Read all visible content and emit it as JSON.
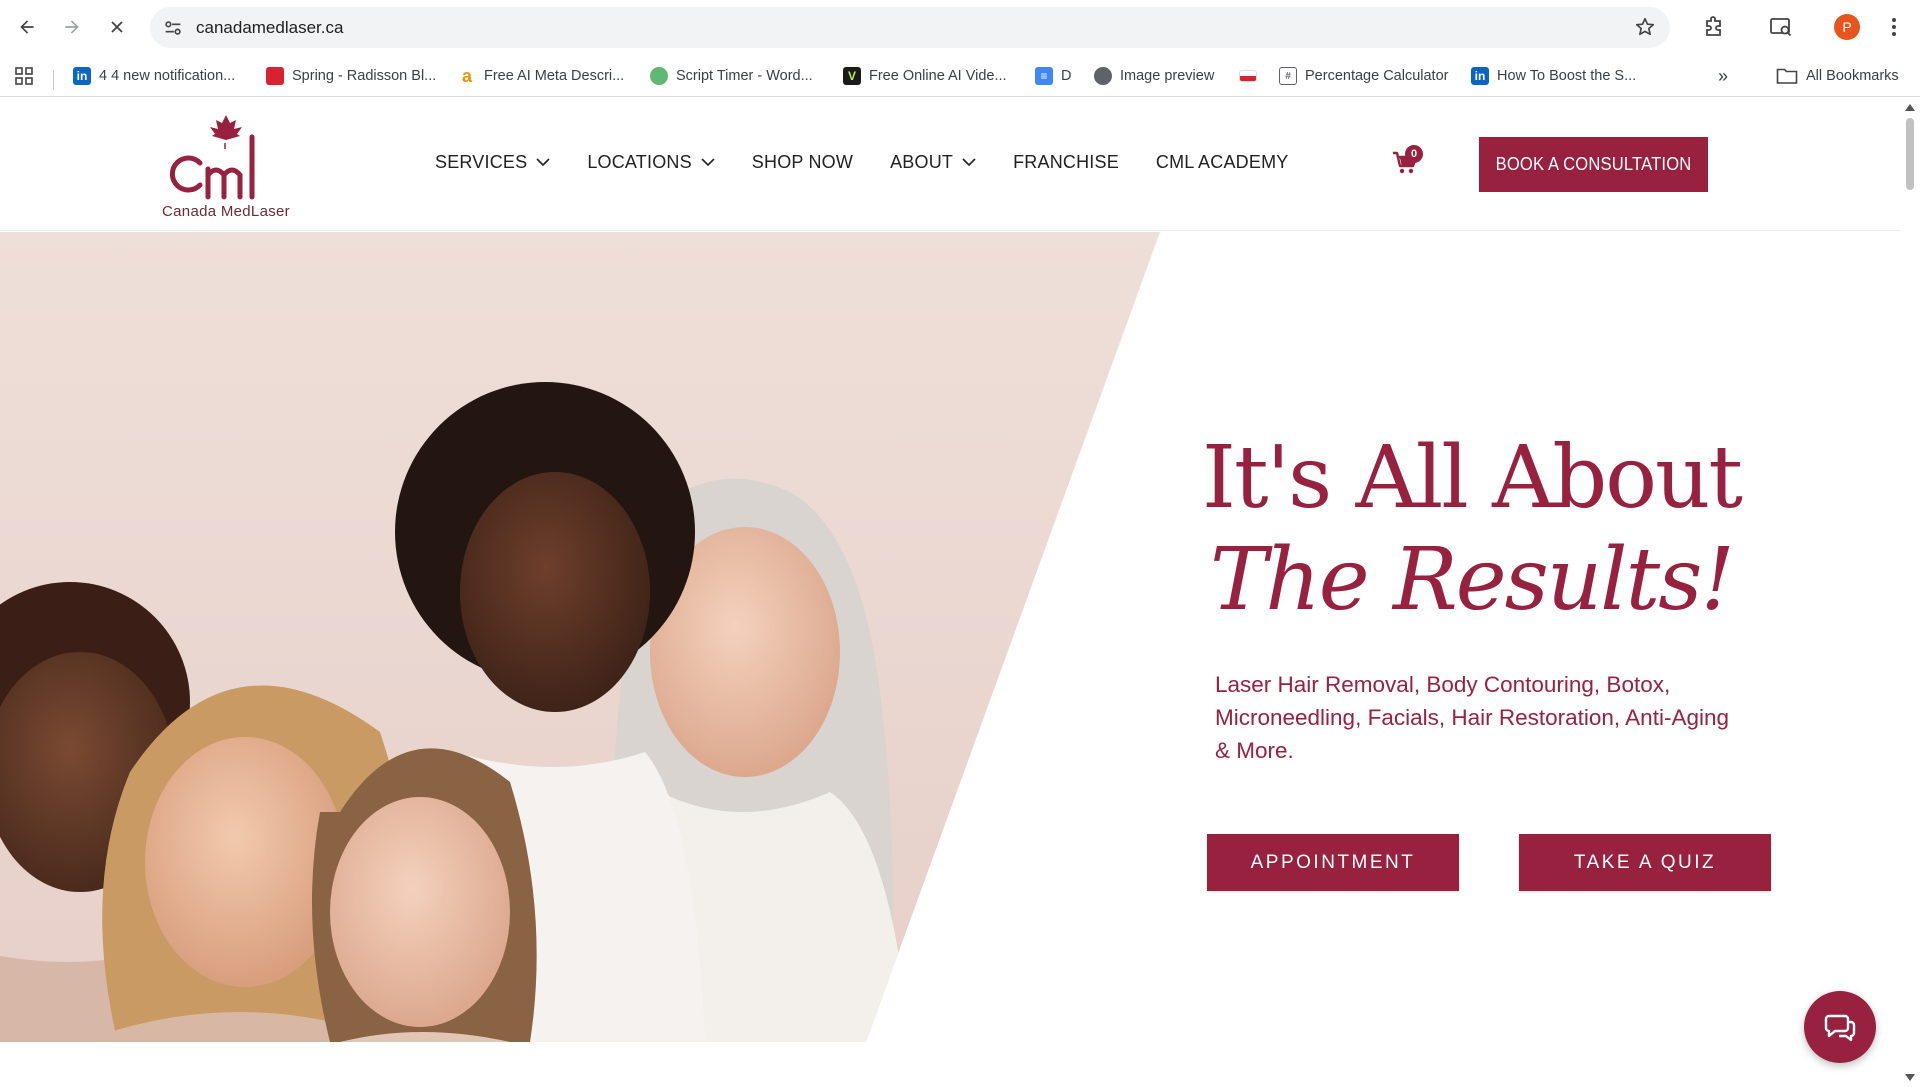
{
  "browser": {
    "url": "canadamedlaser.ca",
    "profile_initial": "P",
    "bookmarks": [
      {
        "label": "4 4 new notification...",
        "icon": "linkedin-icon",
        "color": "#0a66c2"
      },
      {
        "label": "Spring - Radisson Bl...",
        "icon": "radisson-icon",
        "color": "#d6232f"
      },
      {
        "label": "Free AI Meta Descri...",
        "icon": "amazon-a-icon",
        "color": "#f29100"
      },
      {
        "label": "Script Timer - Word...",
        "icon": "timer-icon",
        "color": "#5fb874"
      },
      {
        "label": "Free Online AI Vide...",
        "icon": "v-logo-icon",
        "color": "#1b1b1b"
      },
      {
        "label": "D",
        "icon": "google-docs-icon",
        "color": "#4285f4"
      },
      {
        "label": "Image preview",
        "icon": "globe-icon",
        "color": "#5f6368"
      },
      {
        "label": "",
        "icon": "flag-icon",
        "color": "#d6232f"
      },
      {
        "label": "Percentage Calculator",
        "icon": "calculator-icon",
        "color": "#5f6368"
      },
      {
        "label": "How To Boost the S...",
        "icon": "linkedin-icon",
        "color": "#0a66c2"
      }
    ],
    "all_bookmarks_label": "All Bookmarks"
  },
  "site": {
    "logo_text": "Canada MedLaser",
    "nav": [
      {
        "label": "SERVICES",
        "has_dropdown": true
      },
      {
        "label": "LOCATIONS",
        "has_dropdown": true
      },
      {
        "label": "SHOP NOW",
        "has_dropdown": false
      },
      {
        "label": "ABOUT",
        "has_dropdown": true
      },
      {
        "label": "FRANCHISE",
        "has_dropdown": false
      },
      {
        "label": "CML ACADEMY",
        "has_dropdown": false
      }
    ],
    "cart_count": "0",
    "book_button": "BOOK A CONSULTATION"
  },
  "hero": {
    "headline_line1": "It's All About",
    "headline_line2": "The Results!",
    "subtext": "Laser Hair Removal, Body Contouring, Botox, Microneedling, Facials, Hair Restoration, Anti-Aging & More.",
    "primary_cta": "APPOINTMENT",
    "secondary_cta": "TAKE A QUIZ"
  },
  "colors": {
    "brand": "#98213f",
    "photo_bg": "#ecd9d3"
  }
}
